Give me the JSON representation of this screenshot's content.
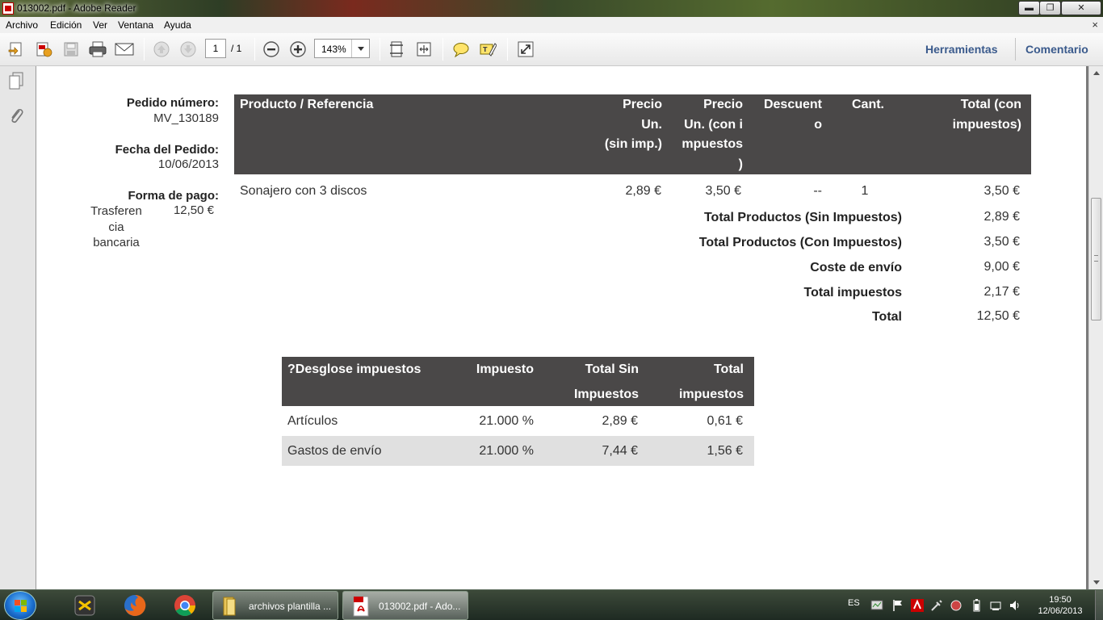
{
  "window": {
    "title": "013002.pdf - Adobe Reader",
    "min": "▬",
    "max": "❐",
    "close": "✕"
  },
  "menu": {
    "items": [
      "Archivo",
      "Edición",
      "Ver",
      "Ventana",
      "Ayuda"
    ],
    "close_doc": "×"
  },
  "toolbar": {
    "page_current": "1",
    "page_total": "/ 1",
    "zoom": "143%",
    "tools_label": "Herramientas",
    "comment_label": "Comentario"
  },
  "invoice": {
    "order_label": "Pedido número:",
    "order_value": "MV_130189",
    "date_label": "Fecha del Pedido:",
    "date_value": "10/06/2013",
    "payment_label": "Forma de pago:",
    "payment_method": [
      "Trasferen",
      "cia",
      "bancaria"
    ],
    "payment_amount": "12,50 €",
    "products_table": {
      "headers": {
        "product": "Producto / Referencia",
        "unit_price": [
          "Precio",
          "Un.",
          "(sin imp.)"
        ],
        "unit_price_tax": [
          "Precio",
          "Un. (con i",
          "mpuestos",
          ")"
        ],
        "discount": [
          "Descuent",
          "o"
        ],
        "qty": "Cant.",
        "total": [
          "Total (con",
          "impuestos)"
        ]
      },
      "rows": [
        {
          "product": "Sonajero con 3 discos",
          "unit_price": "2,89 €",
          "unit_price_tax": "3,50 €",
          "discount": "--",
          "qty": "1",
          "total": "3,50 €"
        }
      ]
    },
    "totals": [
      {
        "label": "Total Productos (Sin Impuestos)",
        "value": "2,89 €"
      },
      {
        "label": "Total Productos (Con Impuestos)",
        "value": "3,50 €"
      },
      {
        "label": "Coste de envío",
        "value": "9,00 €"
      },
      {
        "label": "Total impuestos",
        "value": "2,17 €"
      },
      {
        "label": "Total",
        "value": "12,50 €"
      }
    ],
    "tax_table": {
      "headers": {
        "breakdown": "?Desglose impuestos",
        "tax": "Impuesto",
        "total_excl": [
          "Total Sin",
          "Impuestos"
        ],
        "total": [
          "Total",
          "impuestos"
        ]
      },
      "rows": [
        {
          "name": "Artículos",
          "rate": "21.000 %",
          "base": "2,89 €",
          "tax": "0,61 €"
        },
        {
          "name": "Gastos de envío",
          "rate": "21.000 %",
          "base": "7,44 €",
          "tax": "1,56 €"
        }
      ]
    }
  },
  "taskbar": {
    "tasks": [
      {
        "label": "archivos plantilla ..."
      },
      {
        "label": "013002.pdf - Ado..."
      }
    ],
    "lang": "ES",
    "time": "19:50",
    "date": "12/06/2013"
  },
  "colors": {
    "table_header_bg": "#4a4848",
    "accent_link": "#3a5a8c",
    "alt_row_bg": "#e0e0e0"
  },
  "icons": [
    "create-pdf-icon",
    "export-pdf-icon",
    "save-icon",
    "print-icon",
    "email-icon",
    "page-up-icon",
    "page-down-icon",
    "zoom-out-icon",
    "zoom-in-icon",
    "fit-page-icon",
    "fit-width-icon",
    "comment-icon",
    "highlight-icon",
    "fullscreen-icon",
    "pages-panel-icon",
    "attachments-icon",
    "windows-start-icon",
    "firefox-icon",
    "chrome-icon",
    "folder-icon",
    "pdf-icon"
  ]
}
